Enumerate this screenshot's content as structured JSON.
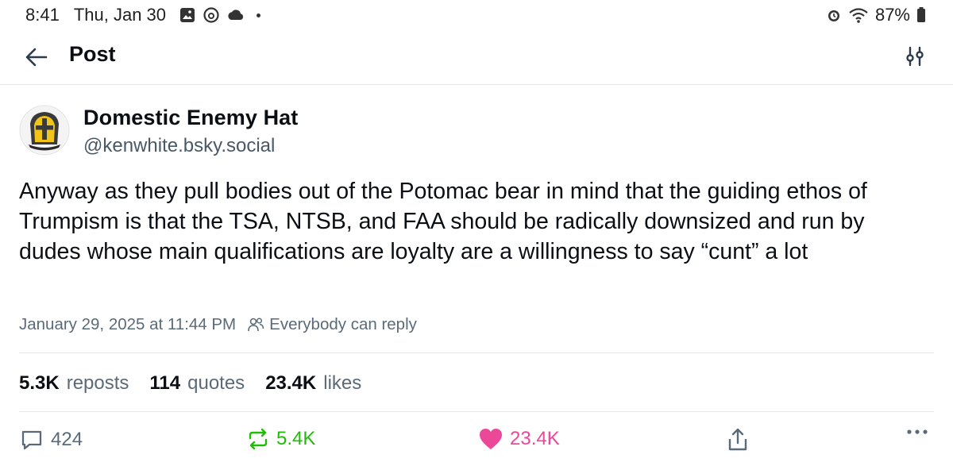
{
  "status_bar": {
    "time": "8:41",
    "date": "Thu, Jan 30",
    "battery": "87%"
  },
  "header": {
    "title": "Post"
  },
  "post": {
    "author_name": "Domestic Enemy Hat",
    "author_handle": "@kenwhite.bsky.social",
    "text": "Anyway as they pull bodies out of the Potomac bear in mind that the guiding ethos of Trumpism is that the TSA, NTSB, and FAA should be radically downsized and run by dudes whose main qualifications are loyalty are a willingness to say “cunt” a lot",
    "timestamp": "January 29, 2025 at 11:44 PM",
    "reply_setting": "Everybody can reply"
  },
  "counts": {
    "reposts_num": "5.3K",
    "reposts_label": "reposts",
    "quotes_num": "114",
    "quotes_label": "quotes",
    "likes_num": "23.4K",
    "likes_label": "likes"
  },
  "actions": {
    "reply_count": "424",
    "repost_count": "5.4K",
    "like_count": "23.4K"
  },
  "colors": {
    "repost_green": "#20bc07",
    "like_pink": "#ec4899",
    "muted": "#5b6a79",
    "accent": "#2a3b4c"
  }
}
